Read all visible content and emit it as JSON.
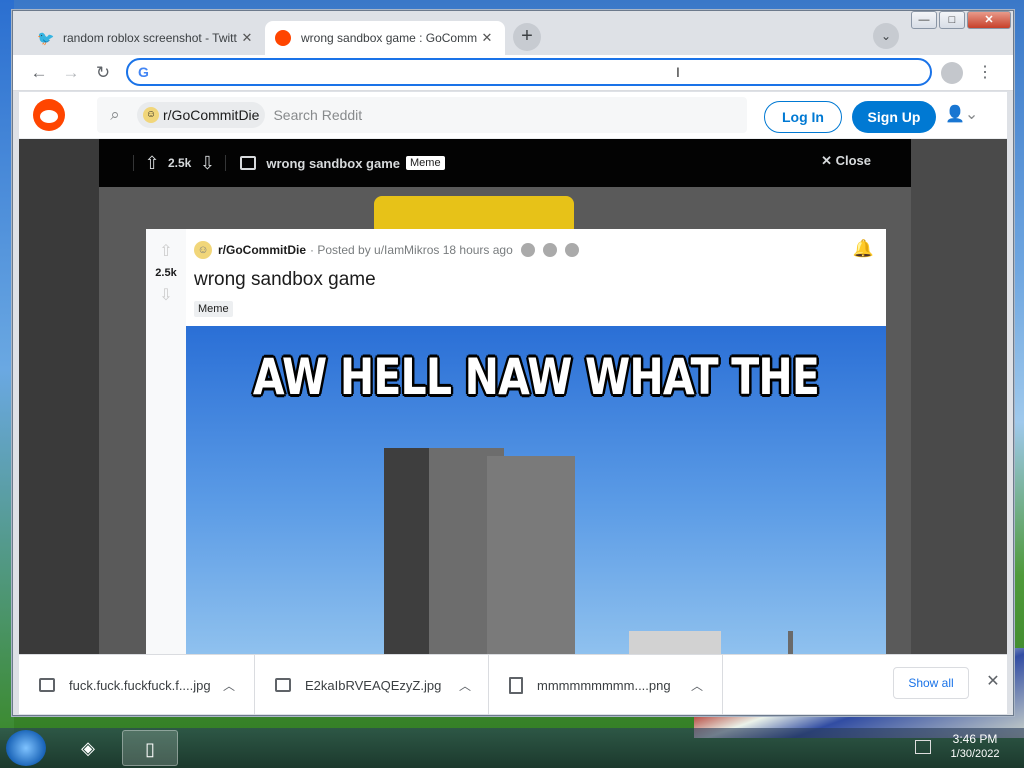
{
  "browser": {
    "tabs": [
      {
        "title": "random roblox screenshot - Twitt",
        "favicon": "twitter-icon",
        "active": false
      },
      {
        "title": "wrong sandbox game : GoComm",
        "favicon": "reddit-icon",
        "active": true
      }
    ],
    "omnibox_value": "",
    "window_controls": {
      "minimize": "—",
      "maximize": "□",
      "close": "✕"
    }
  },
  "reddit": {
    "subreddit": "r/GoCommitDie",
    "search_placeholder": "Search Reddit",
    "login_label": "Log In",
    "signup_label": "Sign Up"
  },
  "overlay": {
    "score": "2.5k",
    "title": "wrong sandbox game",
    "flair": "Meme",
    "close_label": "Close"
  },
  "post": {
    "subreddit": "r/GoCommitDie",
    "posted_by": "· Posted by u/IamMikros 18 hours ago",
    "score": "2.5k",
    "title": "wrong sandbox game",
    "flair": "Meme",
    "meme_caption": "AW HELL NAW WHAT THE"
  },
  "downloads": {
    "items": [
      {
        "name": "fuck.fuck.fuckfuck.f....jpg",
        "icon": "image-file-icon"
      },
      {
        "name": "E2kaIbRVEAQEzyZ.jpg",
        "icon": "image-file-icon"
      },
      {
        "name": "mmmmmmmmm....png",
        "icon": "file-icon"
      }
    ],
    "show_all_label": "Show all"
  },
  "taskbar": {
    "time": "3:46 PM",
    "date": "1/30/2022"
  },
  "colors": {
    "reddit_orange": "#ff4500",
    "reddit_blue": "#0079d3",
    "chrome_blue": "#1a73e8"
  }
}
